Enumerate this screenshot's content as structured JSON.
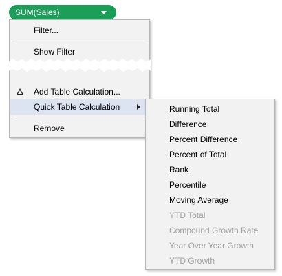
{
  "pill": {
    "label": "SUM(Sales)",
    "color": "#1a9e58"
  },
  "menu": {
    "filter": "Filter...",
    "show_filter": "Show Filter",
    "add_table_calc": "Add Table Calculation...",
    "quick_table_calc": "Quick Table Calculation",
    "remove": "Remove"
  },
  "submenu": {
    "items": [
      {
        "label": "Running Total",
        "enabled": true
      },
      {
        "label": "Difference",
        "enabled": true
      },
      {
        "label": "Percent Difference",
        "enabled": true
      },
      {
        "label": "Percent of Total",
        "enabled": true
      },
      {
        "label": "Rank",
        "enabled": true
      },
      {
        "label": "Percentile",
        "enabled": true
      },
      {
        "label": "Moving Average",
        "enabled": true
      },
      {
        "label": "YTD Total",
        "enabled": false
      },
      {
        "label": "Compound Growth Rate",
        "enabled": false
      },
      {
        "label": "Year Over Year Growth",
        "enabled": false
      },
      {
        "label": "YTD Growth",
        "enabled": false
      }
    ]
  },
  "icons": {
    "add_table_calc": "delta-icon",
    "quick_table_calc": "submenu-arrow-icon",
    "pill": "dropdown-caret-icon"
  }
}
